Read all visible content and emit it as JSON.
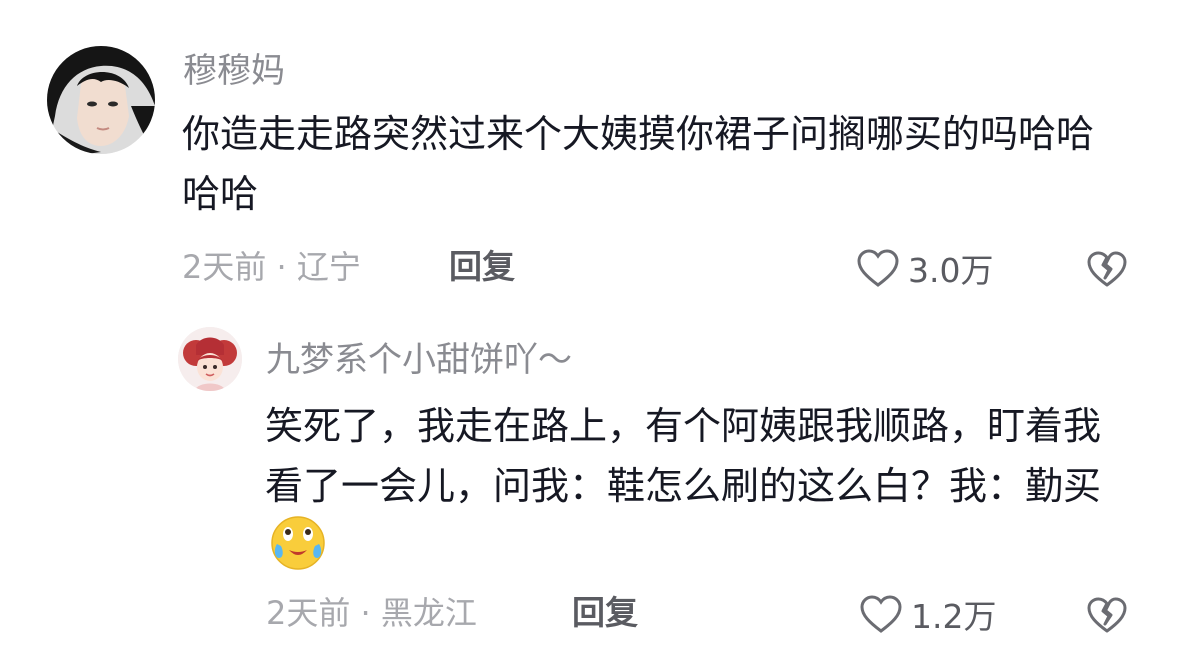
{
  "comment": {
    "username": "穆穆妈",
    "text": "你造走走路突然过来个大姨摸你裙子问搁哪买的吗哈哈哈哈",
    "time_location": "2天前 · 辽宁",
    "reply_label": "回复",
    "like_count": "3.0万"
  },
  "reply": {
    "username": "九梦系个小甜饼吖～",
    "text": "笑死了，我走在路上，有个阿姨跟我顺路，盯着我看了一会儿，问我：鞋怎么刷的这么白？我：勤买",
    "emoji": "laughing-crying-emoji",
    "time_location": "2天前 · 黑龙江",
    "reply_label": "回复",
    "like_count": "1.2万"
  },
  "icons": {
    "like": "heart-outline-icon",
    "dislike": "broken-heart-icon"
  }
}
